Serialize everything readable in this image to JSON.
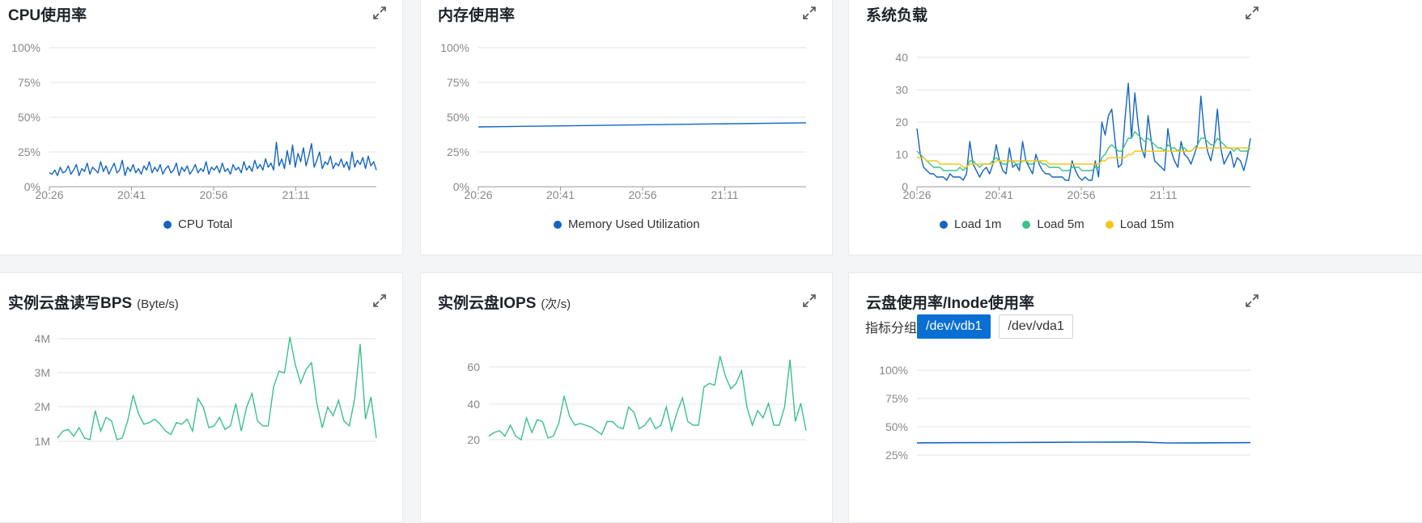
{
  "colors": {
    "blue": "#1565c0",
    "green": "#3cc08b",
    "yellow": "#f5c518",
    "grid": "#e1e3e6",
    "axis": "#888888"
  },
  "panels": [
    {
      "title": "CPU使用率",
      "unit": "",
      "expand_icon": "expand-icon"
    },
    {
      "title": "内存使用率",
      "unit": "",
      "expand_icon": "expand-icon"
    },
    {
      "title": "系统负载",
      "unit": "",
      "expand_icon": "expand-icon"
    },
    {
      "title": "实例云盘读写BPS",
      "unit": "(Byte/s)",
      "expand_icon": "expand-icon"
    },
    {
      "title": "实例云盘IOPS",
      "unit": "(次/s)",
      "expand_icon": "expand-icon"
    },
    {
      "title": "云盘使用率/Inode使用率",
      "unit": "",
      "expand_icon": "expand-icon"
    }
  ],
  "disk_group": {
    "label": "指标分组",
    "options": [
      "/dev/vdb1",
      "/dev/vda1"
    ],
    "selected": "/dev/vdb1"
  },
  "chart_data": [
    {
      "id": "cpu",
      "type": "line",
      "title": "CPU使用率",
      "x_ticks": [
        "20:26",
        "20:41",
        "20:56",
        "21:11"
      ],
      "y_ticks": [
        "100%",
        "75%",
        "50%",
        "25%",
        "0%"
      ],
      "ylim": [
        0,
        100
      ],
      "series": [
        {
          "name": "CPU Total",
          "color": "#1565c0",
          "values": [
            10,
            9,
            12,
            8,
            14,
            10,
            11,
            15,
            9,
            12,
            16,
            8,
            13,
            11,
            17,
            9,
            14,
            12,
            10,
            18,
            11,
            15,
            9,
            13,
            17,
            10,
            12,
            19,
            8,
            14,
            11,
            16,
            10,
            13,
            9,
            15,
            12,
            18,
            10,
            14,
            11,
            16,
            9,
            13,
            15,
            10,
            12,
            17,
            8,
            14,
            11,
            15,
            9,
            12,
            16,
            10,
            13,
            11,
            18,
            9,
            14,
            12,
            15,
            10,
            17,
            11,
            13,
            9,
            16,
            12,
            14,
            10,
            18,
            12,
            15,
            11,
            19,
            13,
            16,
            12,
            20,
            14,
            17,
            12,
            32,
            15,
            20,
            13,
            26,
            16,
            30,
            14,
            24,
            18,
            28,
            15,
            22,
            31,
            14,
            19,
            25,
            13,
            18,
            16,
            22,
            13,
            17,
            15,
            20,
            14,
            18,
            12,
            25,
            14,
            19,
            16,
            21,
            13,
            22,
            15,
            18,
            12
          ]
        }
      ]
    },
    {
      "id": "memory",
      "type": "line",
      "title": "内存使用率",
      "x_ticks": [
        "20:26",
        "20:41",
        "20:56",
        "21:11"
      ],
      "y_ticks": [
        "100%",
        "75%",
        "50%",
        "25%",
        "0%"
      ],
      "ylim": [
        0,
        100
      ],
      "series": [
        {
          "name": "Memory Used Utilization",
          "color": "#1565c0",
          "values": [
            43,
            44,
            45,
            46
          ]
        }
      ]
    },
    {
      "id": "load",
      "type": "line",
      "title": "系统负载",
      "x_ticks": [
        "20:26",
        "20:41",
        "20:56",
        "21:11"
      ],
      "y_ticks": [
        "40",
        "30",
        "20",
        "10",
        "0"
      ],
      "ylim": [
        0,
        40
      ],
      "series": [
        {
          "name": "Load 1m",
          "color": "#1565c0",
          "values": [
            18,
            10,
            6,
            5,
            4,
            4,
            3,
            3,
            3,
            2,
            4,
            3,
            3,
            3,
            2,
            4,
            14,
            7,
            5,
            3,
            5,
            6,
            4,
            7,
            13,
            8,
            5,
            4,
            12,
            6,
            7,
            5,
            14,
            8,
            6,
            4,
            10,
            7,
            5,
            4,
            4,
            3,
            3,
            3,
            3,
            2,
            2,
            8,
            5,
            3,
            2,
            3,
            2,
            2,
            8,
            3,
            20,
            16,
            22,
            24,
            14,
            6,
            7,
            21,
            32,
            15,
            29,
            19,
            12,
            9,
            22,
            14,
            8,
            7,
            6,
            5,
            18,
            11,
            8,
            6,
            14,
            10,
            9,
            7,
            10,
            13,
            28,
            17,
            11,
            8,
            13,
            24,
            12,
            7,
            9,
            11,
            6,
            9,
            8,
            5,
            9,
            15
          ]
        },
        {
          "name": "Load 5m",
          "color": "#3cc08b",
          "values": [
            11,
            10,
            9,
            8,
            7,
            6,
            6,
            6,
            5,
            5,
            5,
            5,
            5,
            6,
            5,
            6,
            8,
            8,
            7,
            6,
            7,
            7,
            7,
            8,
            9,
            8,
            7,
            7,
            8,
            8,
            7,
            7,
            8,
            8,
            7,
            7,
            8,
            8,
            7,
            7,
            6,
            6,
            6,
            6,
            5,
            5,
            5,
            6,
            6,
            6,
            5,
            5,
            5,
            5,
            6,
            6,
            9,
            10,
            12,
            13,
            12,
            11,
            11,
            13,
            15,
            15,
            17,
            16,
            15,
            14,
            15,
            14,
            13,
            12,
            12,
            11,
            13,
            12,
            12,
            11,
            12,
            12,
            11,
            11,
            12,
            13,
            15,
            15,
            14,
            13,
            13,
            15,
            14,
            13,
            12,
            12,
            11,
            12,
            11,
            11,
            11,
            12
          ]
        },
        {
          "name": "Load 15m",
          "color": "#f5c518",
          "values": [
            9,
            9,
            9,
            8,
            8,
            8,
            8,
            7,
            7,
            7,
            7,
            7,
            7,
            7,
            6,
            6,
            7,
            7,
            7,
            7,
            7,
            7,
            7,
            7,
            8,
            8,
            8,
            8,
            8,
            8,
            8,
            8,
            8,
            8,
            8,
            8,
            8,
            8,
            8,
            8,
            7,
            7,
            7,
            7,
            7,
            7,
            7,
            7,
            7,
            7,
            7,
            7,
            7,
            7,
            7,
            7,
            8,
            8,
            9,
            9,
            9,
            9,
            9,
            9,
            10,
            10,
            11,
            11,
            11,
            11,
            11,
            11,
            11,
            11,
            11,
            11,
            11,
            11,
            11,
            11,
            11,
            11,
            11,
            11,
            12,
            12,
            12,
            12,
            12,
            12,
            12,
            12,
            12,
            12,
            12,
            12,
            12,
            12,
            12,
            12,
            12,
            12
          ]
        }
      ]
    },
    {
      "id": "bps",
      "type": "line",
      "title": "实例云盘读写BPS",
      "y_ticks": [
        "4M",
        "3M",
        "2M",
        "1M"
      ],
      "series": [
        {
          "name": "",
          "color": "#3cc08b",
          "values": [
            1.1,
            1.3,
            1.35,
            1.15,
            1.4,
            1.1,
            1.05,
            1.9,
            1.3,
            1.7,
            1.6,
            1.05,
            1.1,
            1.6,
            2.35,
            1.8,
            1.5,
            1.55,
            1.65,
            1.5,
            1.3,
            1.2,
            1.55,
            1.5,
            1.65,
            1.3,
            2.25,
            2.0,
            1.4,
            1.45,
            1.7,
            1.35,
            1.45,
            2.1,
            1.3,
            2.0,
            2.4,
            1.6,
            1.45,
            1.45,
            2.6,
            3.05,
            3.0,
            4.05,
            3.25,
            2.7,
            3.1,
            3.3,
            2.1,
            1.4,
            2.0,
            1.75,
            2.2,
            1.6,
            1.45,
            2.25,
            3.85,
            1.65,
            2.3,
            1.1
          ]
        }
      ]
    },
    {
      "id": "iops",
      "type": "line",
      "title": "实例云盘IOPS",
      "y_ticks": [
        "60",
        "40",
        "20"
      ],
      "series": [
        {
          "name": "",
          "color": "#3cc08b",
          "values": [
            22,
            24,
            25,
            22,
            28,
            22,
            20,
            32,
            24,
            31,
            30,
            21,
            22,
            29,
            44,
            33,
            28,
            29,
            28,
            27,
            25,
            23,
            30,
            30,
            27,
            26,
            38,
            35,
            26,
            28,
            32,
            26,
            28,
            38,
            25,
            35,
            43,
            30,
            28,
            28,
            49,
            51,
            50,
            66,
            55,
            48,
            51,
            58,
            38,
            28,
            36,
            32,
            40,
            28,
            28,
            38,
            64,
            30,
            40,
            25
          ]
        }
      ]
    },
    {
      "id": "disk",
      "type": "line",
      "title": "云盘使用率/Inode使用率",
      "y_ticks": [
        "100%",
        "75%",
        "50%",
        "25%"
      ],
      "ylim": [
        0,
        100
      ],
      "series": [
        {
          "name": "",
          "color": "#1565c0",
          "values": [
            35.8,
            35.9,
            36.0,
            36.1,
            36.2,
            36.3,
            36.4,
            36.5,
            36.6,
            35.7,
            35.8,
            35.9,
            36.0
          ]
        }
      ]
    }
  ]
}
